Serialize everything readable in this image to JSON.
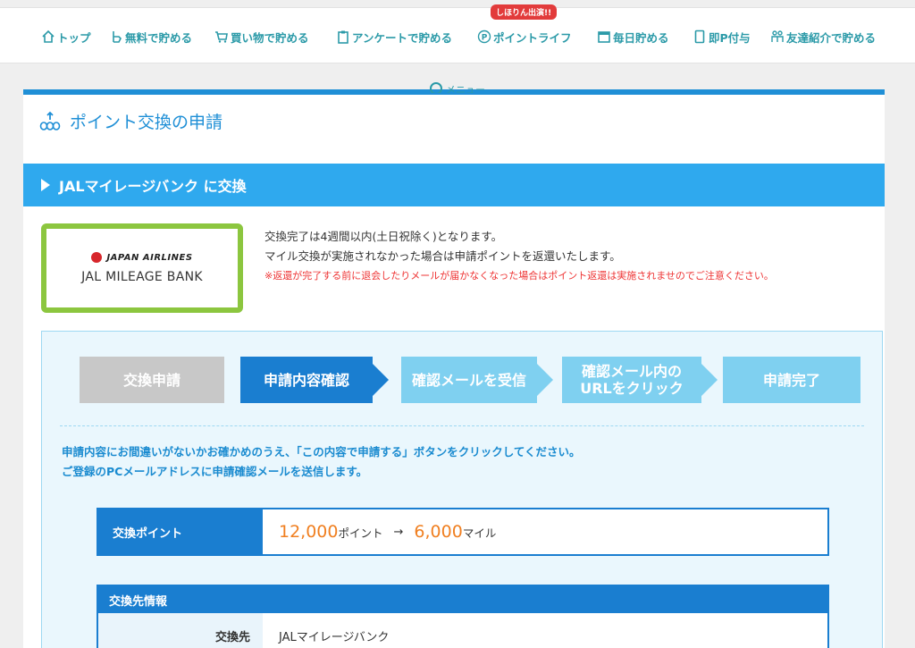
{
  "nav": {
    "items": [
      {
        "label": "トップ",
        "icon": "home-icon"
      },
      {
        "label": "無料で貯める",
        "icon": "hand-icon"
      },
      {
        "label": "買い物で貯める",
        "icon": "cart-icon"
      },
      {
        "label": "アンケートで貯める",
        "icon": "clipboard-icon"
      },
      {
        "label": "ポイントライフ",
        "icon": "p-circle-icon"
      },
      {
        "label": "毎日貯める",
        "icon": "calendar-icon"
      },
      {
        "label": "即P付与",
        "icon": "phone-icon"
      },
      {
        "label": "友達紹介で貯める",
        "icon": "people-icon"
      }
    ],
    "badge": "しほりん出演!!",
    "menu": "メニュー"
  },
  "page": {
    "title": "ポイント交換の申請",
    "section": "JALマイレージバンク に交換"
  },
  "logo": {
    "top": "JAPAN AIRLINES",
    "bottom": "JAL MILEAGE BANK"
  },
  "info": {
    "line1": "交換完了は4週間以内(土日祝除く)となります。",
    "line2": "マイル交換が実施されなかった場合は申請ポイントを返還いたします。",
    "warn": "※返還が完了する前に退会したりメールが届かなくなった場合はポイント返還は実施されませのでご注意ください。"
  },
  "steps": [
    "交換申請",
    "申請内容確認",
    "確認メールを受信",
    "確認メール内の",
    "URLをクリック",
    "申請完了"
  ],
  "instructions": {
    "line1": "申請内容にお間違いがないかお確かめのうえ、「この内容で申請する」ボタンをクリックしてください。",
    "line2": "ご登録のPCメールアドレスに申請確認メールを送信します。"
  },
  "exchange": {
    "label": "交換ポイント",
    "points": "12,000",
    "points_unit": "ポイント",
    "arrow": "→",
    "miles": "6,000",
    "miles_unit": "マイル"
  },
  "destination": {
    "header": "交換先情報",
    "label": "交換先",
    "value": "JALマイレージバンク"
  },
  "colors": {
    "accent": "#1a7ed0",
    "section": "#2fa9ee",
    "nav_text": "#2b9aa8",
    "highlight": "#f07f20",
    "logo_border": "#8cc63f"
  }
}
